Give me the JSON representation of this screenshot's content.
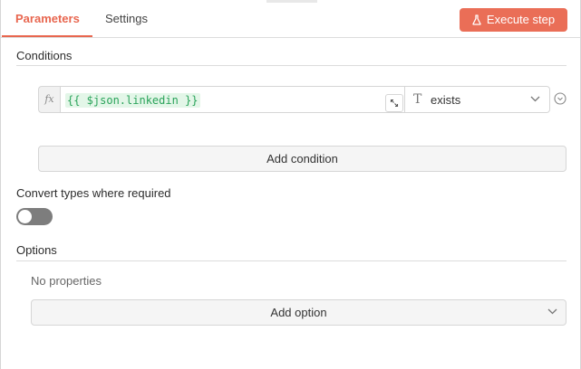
{
  "header": {
    "tabs": [
      {
        "label": "Parameters",
        "active": true
      },
      {
        "label": "Settings",
        "active": false
      }
    ],
    "execute_button": {
      "label": "Execute step",
      "icon": "flask-icon"
    }
  },
  "conditions": {
    "title": "Conditions",
    "rows": [
      {
        "fx_label": "fx",
        "expression": "{{ $json.linkedin }}",
        "operator_type_icon": "T",
        "operator": "exists"
      }
    ],
    "add_button": "Add condition"
  },
  "convert_types": {
    "label": "Convert types where required",
    "enabled": false
  },
  "options": {
    "title": "Options",
    "empty_text": "No properties",
    "add_button": "Add option"
  },
  "colors": {
    "accent": "#ea6e57",
    "expression_bg": "#e3f6e8",
    "expression_text": "#2aa35a"
  }
}
